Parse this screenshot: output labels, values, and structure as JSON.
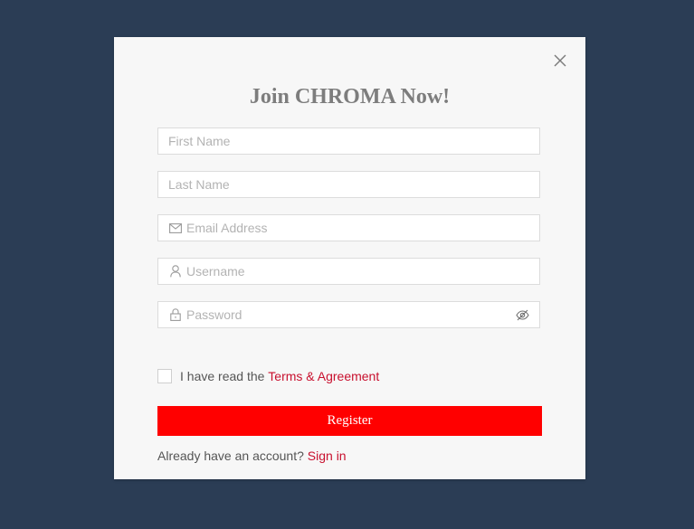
{
  "modal": {
    "title": "Join CHROMA Now!",
    "fields": {
      "first_name": {
        "placeholder": "First Name",
        "value": ""
      },
      "last_name": {
        "placeholder": "Last Name",
        "value": ""
      },
      "email": {
        "placeholder": "Email Address",
        "value": "",
        "icon": "envelope-icon"
      },
      "username": {
        "placeholder": "Username",
        "value": "",
        "icon": "user-icon"
      },
      "password": {
        "placeholder": "Password",
        "value": "",
        "icon": "lock-icon",
        "toggle_icon": "eye-off-icon"
      }
    },
    "terms": {
      "prefix": "I have read the",
      "link_label": "Terms & Agreement",
      "checked": false
    },
    "register_label": "Register",
    "signin": {
      "prompt": "Already have an account?",
      "link_label": "Sign in"
    },
    "close_icon": "close-icon"
  },
  "colors": {
    "background": "#2b3d55",
    "modal_bg": "#f7f7f7",
    "accent": "#ff0000",
    "link": "#c8102e",
    "title": "#7d7d7d"
  }
}
